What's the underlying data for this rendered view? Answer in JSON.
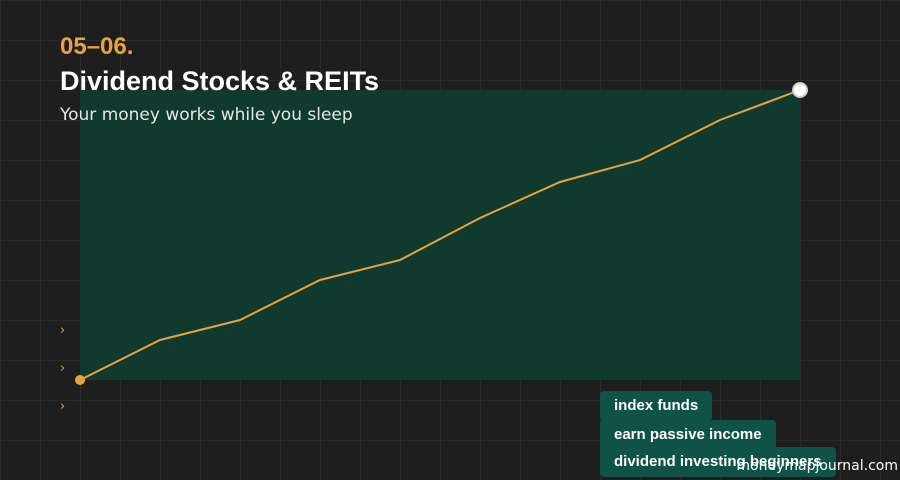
{
  "header": {
    "section_number": "05–06.",
    "title": "Dividend Stocks & REITs",
    "subtitle": "Your money works while you sleep"
  },
  "bullets": [
    {
      "icon": "chevron-right-icon",
      "glyph": "›"
    },
    {
      "icon": "chevron-right-icon",
      "glyph": "›"
    },
    {
      "icon": "chevron-right-icon",
      "glyph": "›"
    }
  ],
  "tags": [
    "index funds",
    "earn passive income",
    "dividend investing beginners"
  ],
  "watermark": "moneymapjournal.com",
  "colors": {
    "background": "#1e1e1e",
    "accent": "#e8a33d",
    "chart_fill": "#113a2f",
    "tag_bg": "#0e5346",
    "end_marker": "#ffffff"
  },
  "chart_data": {
    "type": "line",
    "values": [
      0,
      20,
      30,
      50,
      60,
      81,
      99,
      110,
      130,
      145
    ]
  }
}
